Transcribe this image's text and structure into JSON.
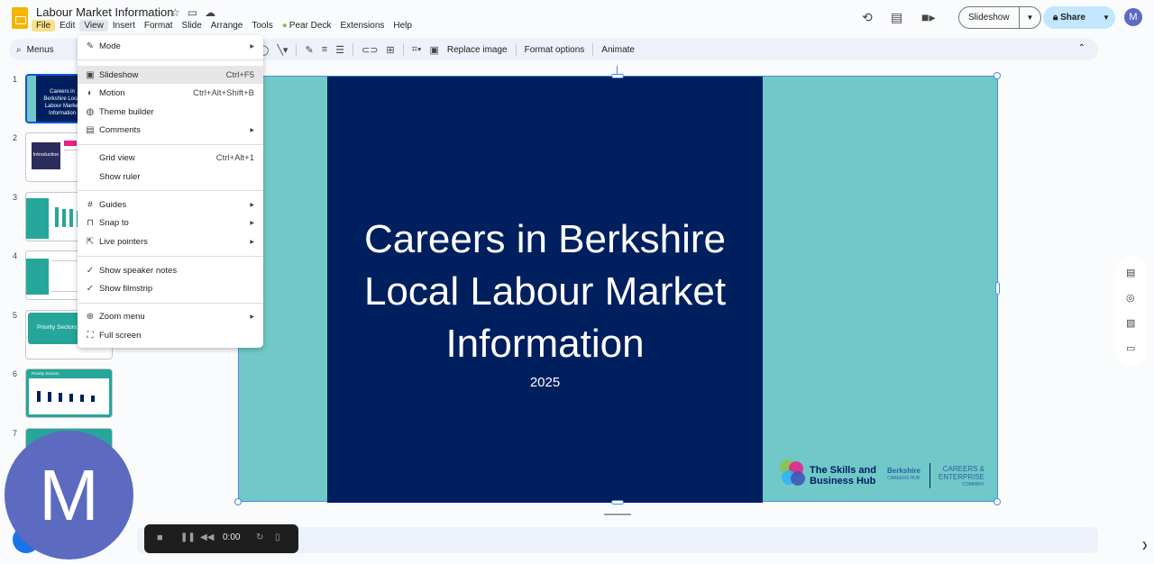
{
  "doc": {
    "title": "Labour Market Information",
    "icons": [
      "star-icon",
      "folder-icon",
      "cloud-icon"
    ]
  },
  "menubar": [
    "File",
    "Edit",
    "View",
    "Insert",
    "Format",
    "Slide",
    "Arrange",
    "Tools",
    "Pear Deck",
    "Extensions",
    "Help"
  ],
  "topright": {
    "slideshow_label": "Slideshow",
    "share_label": "Share",
    "avatar_letter": "M"
  },
  "toolbar": {
    "menus_label": "Menus",
    "replace_image": "Replace image",
    "format_options": "Format options",
    "animate": "Animate"
  },
  "view_menu": {
    "items": [
      {
        "label": "Mode",
        "shortcut": "",
        "submenu": true,
        "icon": "pencil-icon"
      },
      {
        "label": "Slideshow",
        "shortcut": "Ctrl+F5",
        "submenu": false,
        "icon": "slideshow-icon"
      },
      {
        "label": "Motion",
        "shortcut": "Ctrl+Alt+Shift+B",
        "submenu": false,
        "icon": "motion-icon"
      },
      {
        "label": "Theme builder",
        "shortcut": "",
        "submenu": false,
        "icon": "palette-icon"
      },
      {
        "label": "Comments",
        "shortcut": "",
        "submenu": true,
        "icon": "comment-icon"
      },
      {
        "label": "Grid view",
        "shortcut": "Ctrl+Alt+1",
        "submenu": false,
        "icon": ""
      },
      {
        "label": "Show ruler",
        "shortcut": "",
        "submenu": false,
        "icon": ""
      },
      {
        "label": "Guides",
        "shortcut": "",
        "submenu": true,
        "icon": "guides-icon"
      },
      {
        "label": "Snap to",
        "shortcut": "",
        "submenu": true,
        "icon": "snap-icon"
      },
      {
        "label": "Live pointers",
        "shortcut": "",
        "submenu": true,
        "icon": "pointer-icon"
      },
      {
        "label": "Show speaker notes",
        "shortcut": "",
        "submenu": false,
        "icon": "check-icon"
      },
      {
        "label": "Show filmstrip",
        "shortcut": "",
        "submenu": false,
        "icon": "check-icon"
      },
      {
        "label": "Zoom menu",
        "shortcut": "",
        "submenu": true,
        "icon": "zoom-icon"
      },
      {
        "label": "Full screen",
        "shortcut": "",
        "submenu": false,
        "icon": "fullscreen-icon"
      }
    ]
  },
  "filmstrip": {
    "numbers": [
      "1",
      "2",
      "3",
      "4",
      "5",
      "6",
      "7"
    ],
    "thumb1_text": "Careers in Berkshire Local Labour Market Information",
    "thumb2_text": "Introduction",
    "thumb5_text": "Priority Sectors in",
    "thumb6_text": "Priority Sectors"
  },
  "slide": {
    "title_lines": [
      "Careers in Berkshire",
      "Local Labour Market",
      "Information"
    ],
    "subtitle": "2025",
    "logo1": [
      "The Skills and",
      "Business Hub"
    ],
    "logo2": "Berkshire",
    "logo2_sub": "CAREERS HUB",
    "logo3": "CAREERS & ENTERPRISE",
    "logo3_sub": "COMPANY"
  },
  "recording": {
    "time": "0:00",
    "avatar_letter": "M"
  },
  "colors": {
    "slide_navy": "#001f5e",
    "slide_teal": "#71c8c8",
    "accent_blue": "#0b57d0",
    "share_bg": "#c2e7ff"
  }
}
